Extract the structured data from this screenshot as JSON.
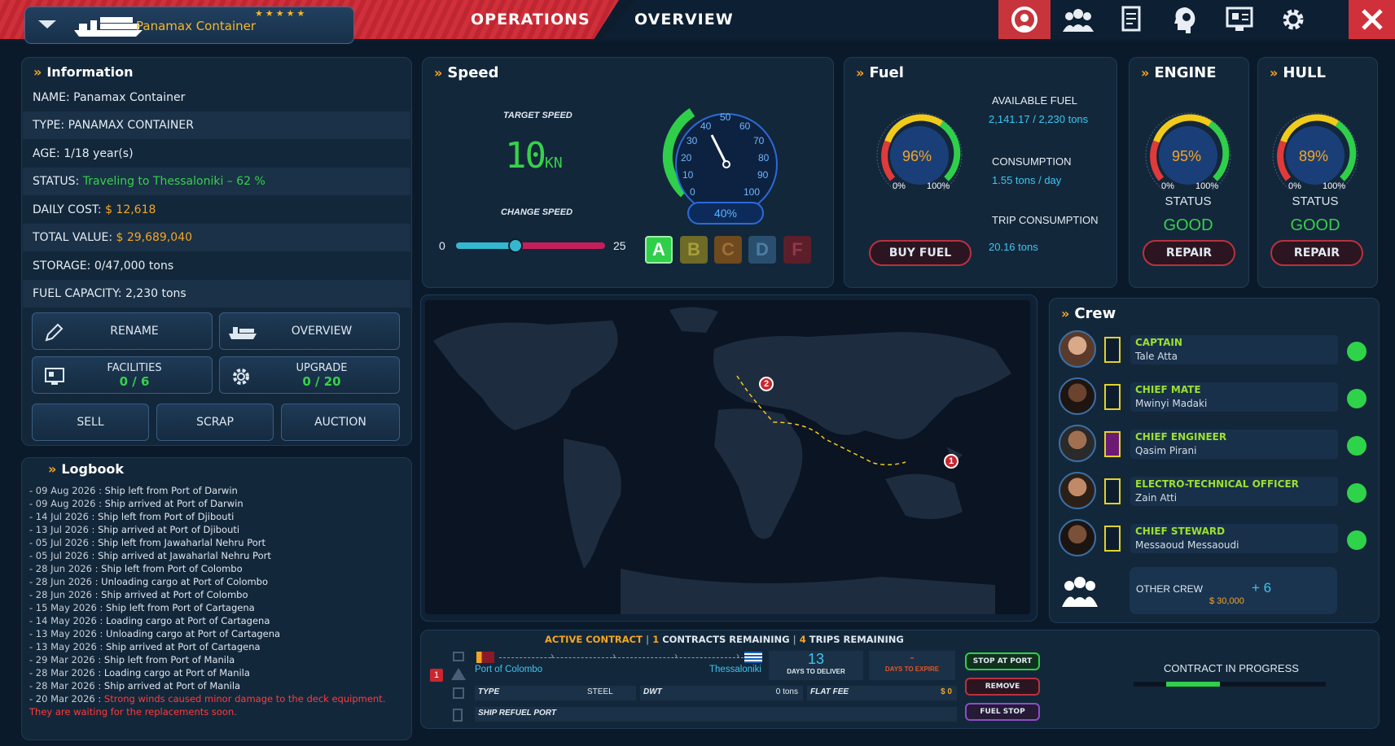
{
  "top": {
    "ship_name": "Panamax Container",
    "stars": "★★★★★",
    "tab_operations": "OPERATIONS",
    "tab_overview": "OVERVIEW",
    "nav_icons": [
      "captain-icon",
      "crew-icon",
      "documents-icon",
      "brain-icon",
      "facilities-icon",
      "gear-icon"
    ]
  },
  "info": {
    "title": "Information",
    "rows": [
      {
        "label": "NAME:",
        "value": "Panamax Container"
      },
      {
        "label": "TYPE:",
        "value": "PANAMAX CONTAINER"
      },
      {
        "label": "AGE:",
        "value": "1/18 year(s)"
      },
      {
        "label": "STATUS:",
        "value": "Traveling to Thessaloniki – 62 %"
      },
      {
        "label": "DAILY COST:",
        "value": "$ 12,618"
      },
      {
        "label": "TOTAL VALUE:",
        "value": "$ 29,689,040"
      },
      {
        "label": "STORAGE:",
        "value": "0/47,000 tons"
      },
      {
        "label": "FUEL CAPACITY:",
        "value": "2,230 tons"
      }
    ],
    "rename": "RENAME",
    "overview": "OVERVIEW",
    "facilities": "FACILITIES",
    "facilities_count": "0 / 6",
    "upgrade": "UPGRADE",
    "upgrade_count": "0 / 20",
    "sell": "SELL",
    "scrap": "SCRAP",
    "auction": "AUCTION"
  },
  "logbook": {
    "title": "Logbook",
    "entries": [
      {
        "date": "- 09 Aug 2026 :",
        "text": "Ship left from Port of Darwin"
      },
      {
        "date": "- 09 Aug 2026 :",
        "text": "Ship arrived at Port of Darwin"
      },
      {
        "date": "- 14 Jul 2026 :",
        "text": "Ship left from Port of Djibouti"
      },
      {
        "date": "- 13 Jul 2026 :",
        "text": "Ship arrived at Port of Djibouti"
      },
      {
        "date": "- 05 Jul 2026 :",
        "text": "Ship left from Jawaharlal Nehru Port"
      },
      {
        "date": "- 05 Jul 2026 :",
        "text": "Ship arrived at Jawaharlal Nehru Port"
      },
      {
        "date": "- 28 Jun 2026 :",
        "text": "Ship left from Port of Colombo"
      },
      {
        "date": "- 28 Jun 2026 :",
        "text": "Unloading cargo at Port of Colombo"
      },
      {
        "date": "- 28 Jun 2026 :",
        "text": "Ship arrived at Port of Colombo"
      },
      {
        "date": "- 15 May 2026 :",
        "text": "Ship left from Port of Cartagena"
      },
      {
        "date": "- 14 May 2026 :",
        "text": "Loading cargo at Port of Cartagena"
      },
      {
        "date": "- 13 May 2026 :",
        "text": "Unloading cargo at Port of Cartagena"
      },
      {
        "date": "- 13 May 2026 :",
        "text": "Ship arrived at Port of Cartagena"
      },
      {
        "date": "- 29 Mar 2026 :",
        "text": "Ship left from Port of Manila"
      },
      {
        "date": "- 28 Mar 2026 :",
        "text": "Loading cargo at Port of Manila"
      },
      {
        "date": "- 28 Mar 2026 :",
        "text": "Ship arrived at Port of Manila"
      }
    ],
    "alert_date": "- 20 Mar 2026 :",
    "alert_text": "Strong winds caused minor damage to the deck equipment. They are waiting for the replacements soon."
  },
  "speed": {
    "title": "Speed",
    "target_label": "TARGET SPEED",
    "target_value": "10",
    "unit": "KN",
    "change_label": "CHANGE SPEED",
    "slider_min": "0",
    "slider_max": "25",
    "slider_fraction": 0.4,
    "gauge_ticks": [
      "0",
      "10",
      "20",
      "30",
      "40",
      "50",
      "60",
      "70",
      "80",
      "90",
      "100"
    ],
    "percent": "40%",
    "grades": [
      "A",
      "B",
      "C",
      "D",
      "F"
    ]
  },
  "fuel": {
    "title": "Fuel",
    "gauge": "96%",
    "min": "0%",
    "max": "100%",
    "available_label": "AVAILABLE FUEL",
    "available_value": "2,141.17 / 2,230 tons",
    "consumption_label": "CONSUMPTION",
    "consumption_value": "1.55 tons / day",
    "trip_label": "TRIP CONSUMPTION",
    "trip_value": "20.16 tons",
    "buy": "BUY FUEL"
  },
  "engine": {
    "title": "ENGINE",
    "gauge": "95%",
    "min": "0%",
    "max": "100%",
    "status_label": "STATUS",
    "status": "GOOD",
    "repair": "REPAIR"
  },
  "hull": {
    "title": "HULL",
    "gauge": "89%",
    "min": "0%",
    "max": "100%",
    "status_label": "STATUS",
    "status": "GOOD",
    "repair": "REPAIR"
  },
  "map": {
    "marker1": "1",
    "marker2": "2"
  },
  "crew": {
    "title": "Crew",
    "members": [
      {
        "role": "CAPTAIN",
        "name": "Tale Atta"
      },
      {
        "role": "CHIEF MATE",
        "name": "Mwinyi Madaki"
      },
      {
        "role": "CHIEF ENGINEER",
        "name": "Qasim Pirani"
      },
      {
        "role": "ELECTRO-TECHNICAL OFFICER",
        "name": "Zain Atti"
      },
      {
        "role": "CHIEF STEWARD",
        "name": "Messaoud Messaoudi"
      }
    ],
    "other_label": "OTHER CREW",
    "other_count": "+ 6",
    "other_cost": "$ 30,000"
  },
  "contract": {
    "active": "ACTIVE CONTRACT",
    "sep": "|",
    "remaining_count": "1",
    "remaining_label": "CONTRACTS REMAINING",
    "trips_count": "4",
    "trips_label": "TRIPS REMAINING",
    "index": "1",
    "from": "Port of Colombo",
    "to": "Thessaloniki",
    "days_deliver": "13",
    "days_deliver_label": "DAYS TO DELIVER",
    "days_expire": "-",
    "days_expire_label": "DAYS TO EXPIRE",
    "type_label": "TYPE",
    "type_value": "STEEL",
    "dwt_label": "DWT",
    "dwt_value": "0 tons",
    "fee_label": "FLAT FEE",
    "fee_value": "$ 0",
    "refuel_label": "SHIP REFUEL PORT",
    "stop_btn": "STOP AT PORT",
    "remove_btn": "REMOVE",
    "fuel_stop_btn": "FUEL STOP",
    "progress_label": "CONTRACT IN PROGRESS",
    "progress_fraction": 0.45
  }
}
